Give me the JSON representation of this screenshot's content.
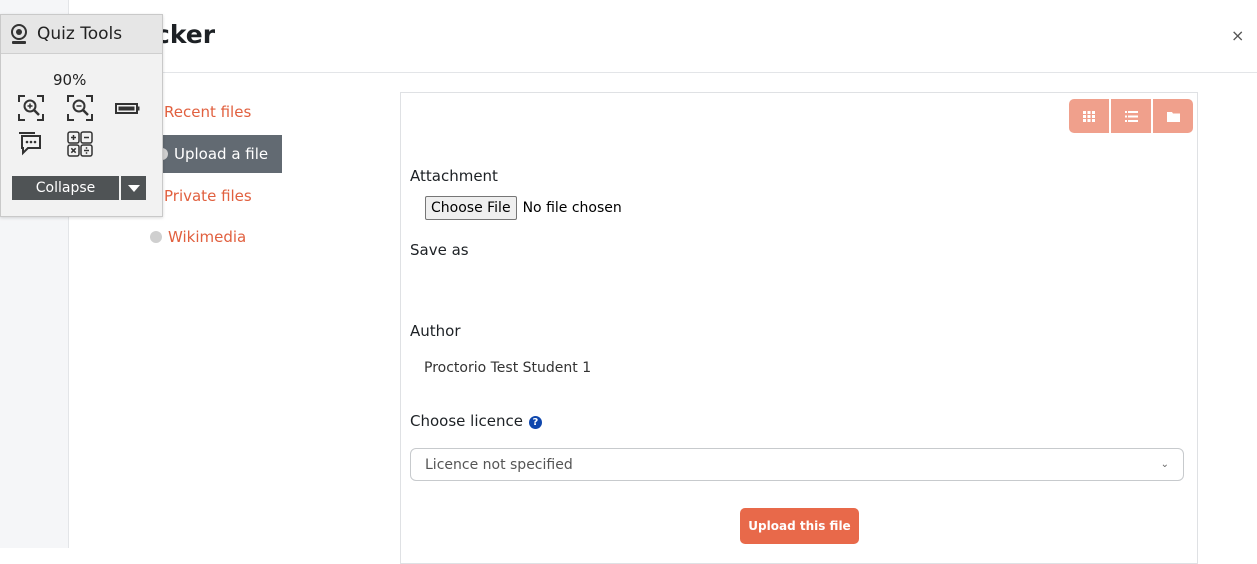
{
  "dialog": {
    "title": "cker",
    "close_symbol": "×"
  },
  "repositories": [
    {
      "label": "Recent files",
      "icon": "recent-files-icon",
      "active": false
    },
    {
      "label": "Upload a file",
      "icon": "upload-icon",
      "active": true
    },
    {
      "label": "Private files",
      "icon": "private-files-icon",
      "active": false
    },
    {
      "label": "Wikimedia",
      "icon": "wikimedia-icon",
      "active": false
    }
  ],
  "view_buttons": [
    "grid-view-icon",
    "list-view-icon",
    "folder-view-icon"
  ],
  "form": {
    "attachment_label": "Attachment",
    "choose_file_button": "Choose File",
    "no_file_text": "No file chosen",
    "save_as_label": "Save as",
    "author_label": "Author",
    "author_value": "Proctorio  Test Student 1",
    "licence_label": "Choose licence",
    "licence_help_symbol": "?",
    "licence_selected": "Licence not specified",
    "upload_button": "Upload this file"
  },
  "quiz_tools": {
    "title": "Quiz Tools",
    "zoom": "90%",
    "collapse_label": "Collapse",
    "icons": [
      "zoom-in-icon",
      "zoom-out-icon",
      "battery-icon",
      "chat-icon",
      "calculator-icon",
      "dropdown-arrow-icon"
    ]
  },
  "colors": {
    "accent": "#e1603f",
    "button_orange": "#e8694a",
    "view_button": "#f0a08c",
    "active_item": "#626a72",
    "help_blue": "#0f47ad"
  }
}
